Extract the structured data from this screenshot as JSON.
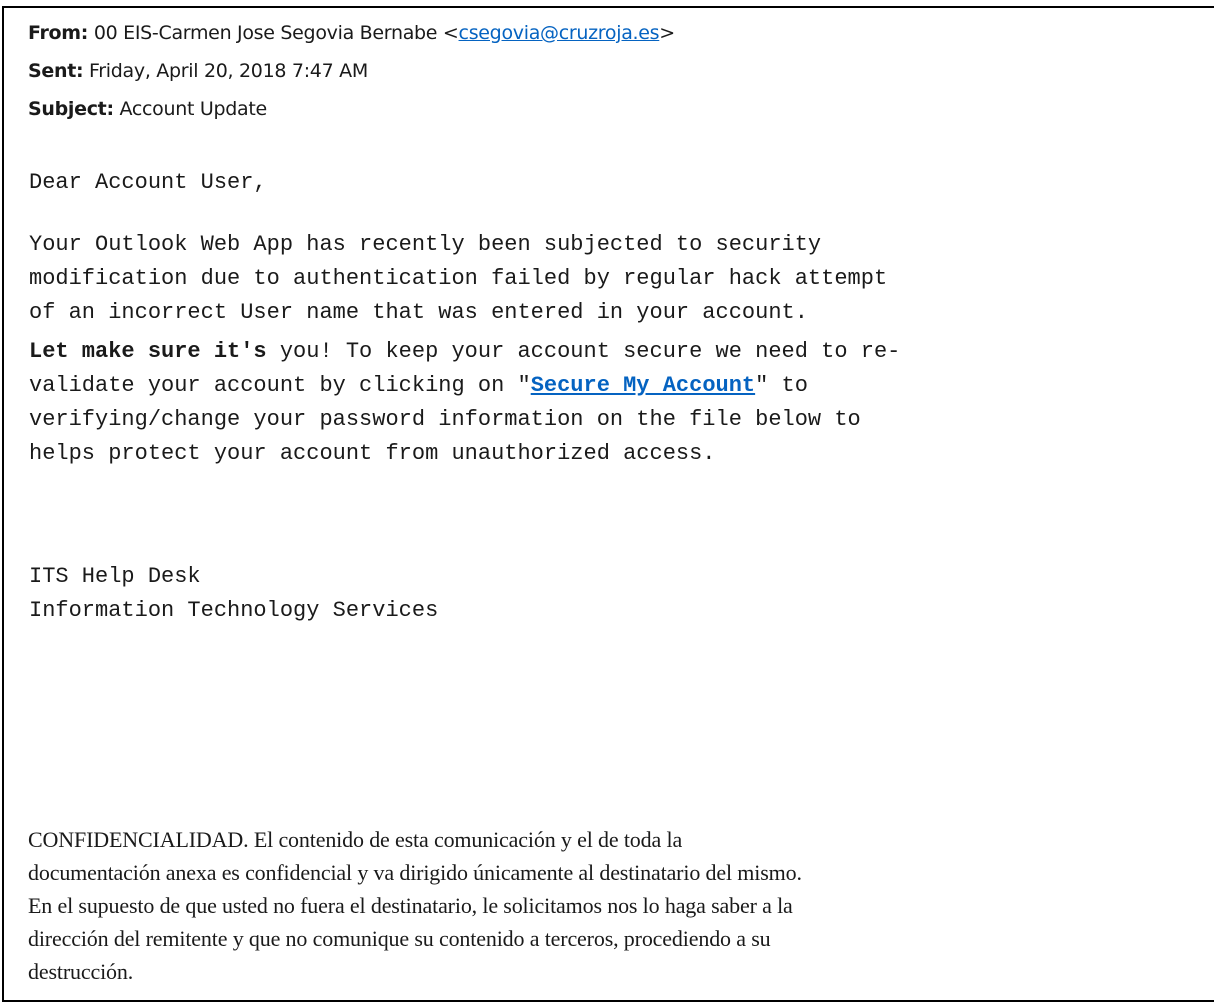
{
  "email": {
    "from_label": "From:",
    "from_name": "00 EIS-Carmen Jose Segovia Bernabe <",
    "from_address": "csegovia@cruzroja.es",
    "from_close": ">",
    "sent_label": "Sent:",
    "sent_value": "Friday, April 20, 2018 7:47 AM",
    "subject_label": "Subject:",
    "subject_value": "Account Update"
  },
  "body": {
    "greeting": "Dear Account User,",
    "para1": [
      "Your Outlook Web App has recently been subjected to security",
      "modification due to authentication failed by regular hack attempt",
      "of an incorrect User name that was entered in your account."
    ],
    "para2_bold": "Let make sure it's",
    "para2_line1_rest": " you! To keep your account secure we need to re-",
    "para2_line2_pre": "validate your account by clicking on \"",
    "link_text": "Secure My Account",
    "para2_line2_post": "\" to",
    "para2_line3": "verifying/change your password information on the file below to",
    "para2_line4": "helps protect your account from unauthorized access.",
    "signature": [
      "ITS Help Desk",
      "Information Technology Services"
    ]
  },
  "confidential": [
    "CONFIDENCIALIDAD. El contenido de esta comunicación y el de toda la",
    "documentación anexa es confidencial y va dirigido únicamente al destinatario del mismo.",
    "En el supuesto de que usted no fuera el destinatario, le solicitamos nos lo haga saber a la",
    "dirección del remitente y que no comunique su contenido a terceros, procediendo a su",
    "destrucción."
  ],
  "colors": {
    "link": "#0563c1",
    "text": "#1a1a1a",
    "border": "#000000"
  }
}
